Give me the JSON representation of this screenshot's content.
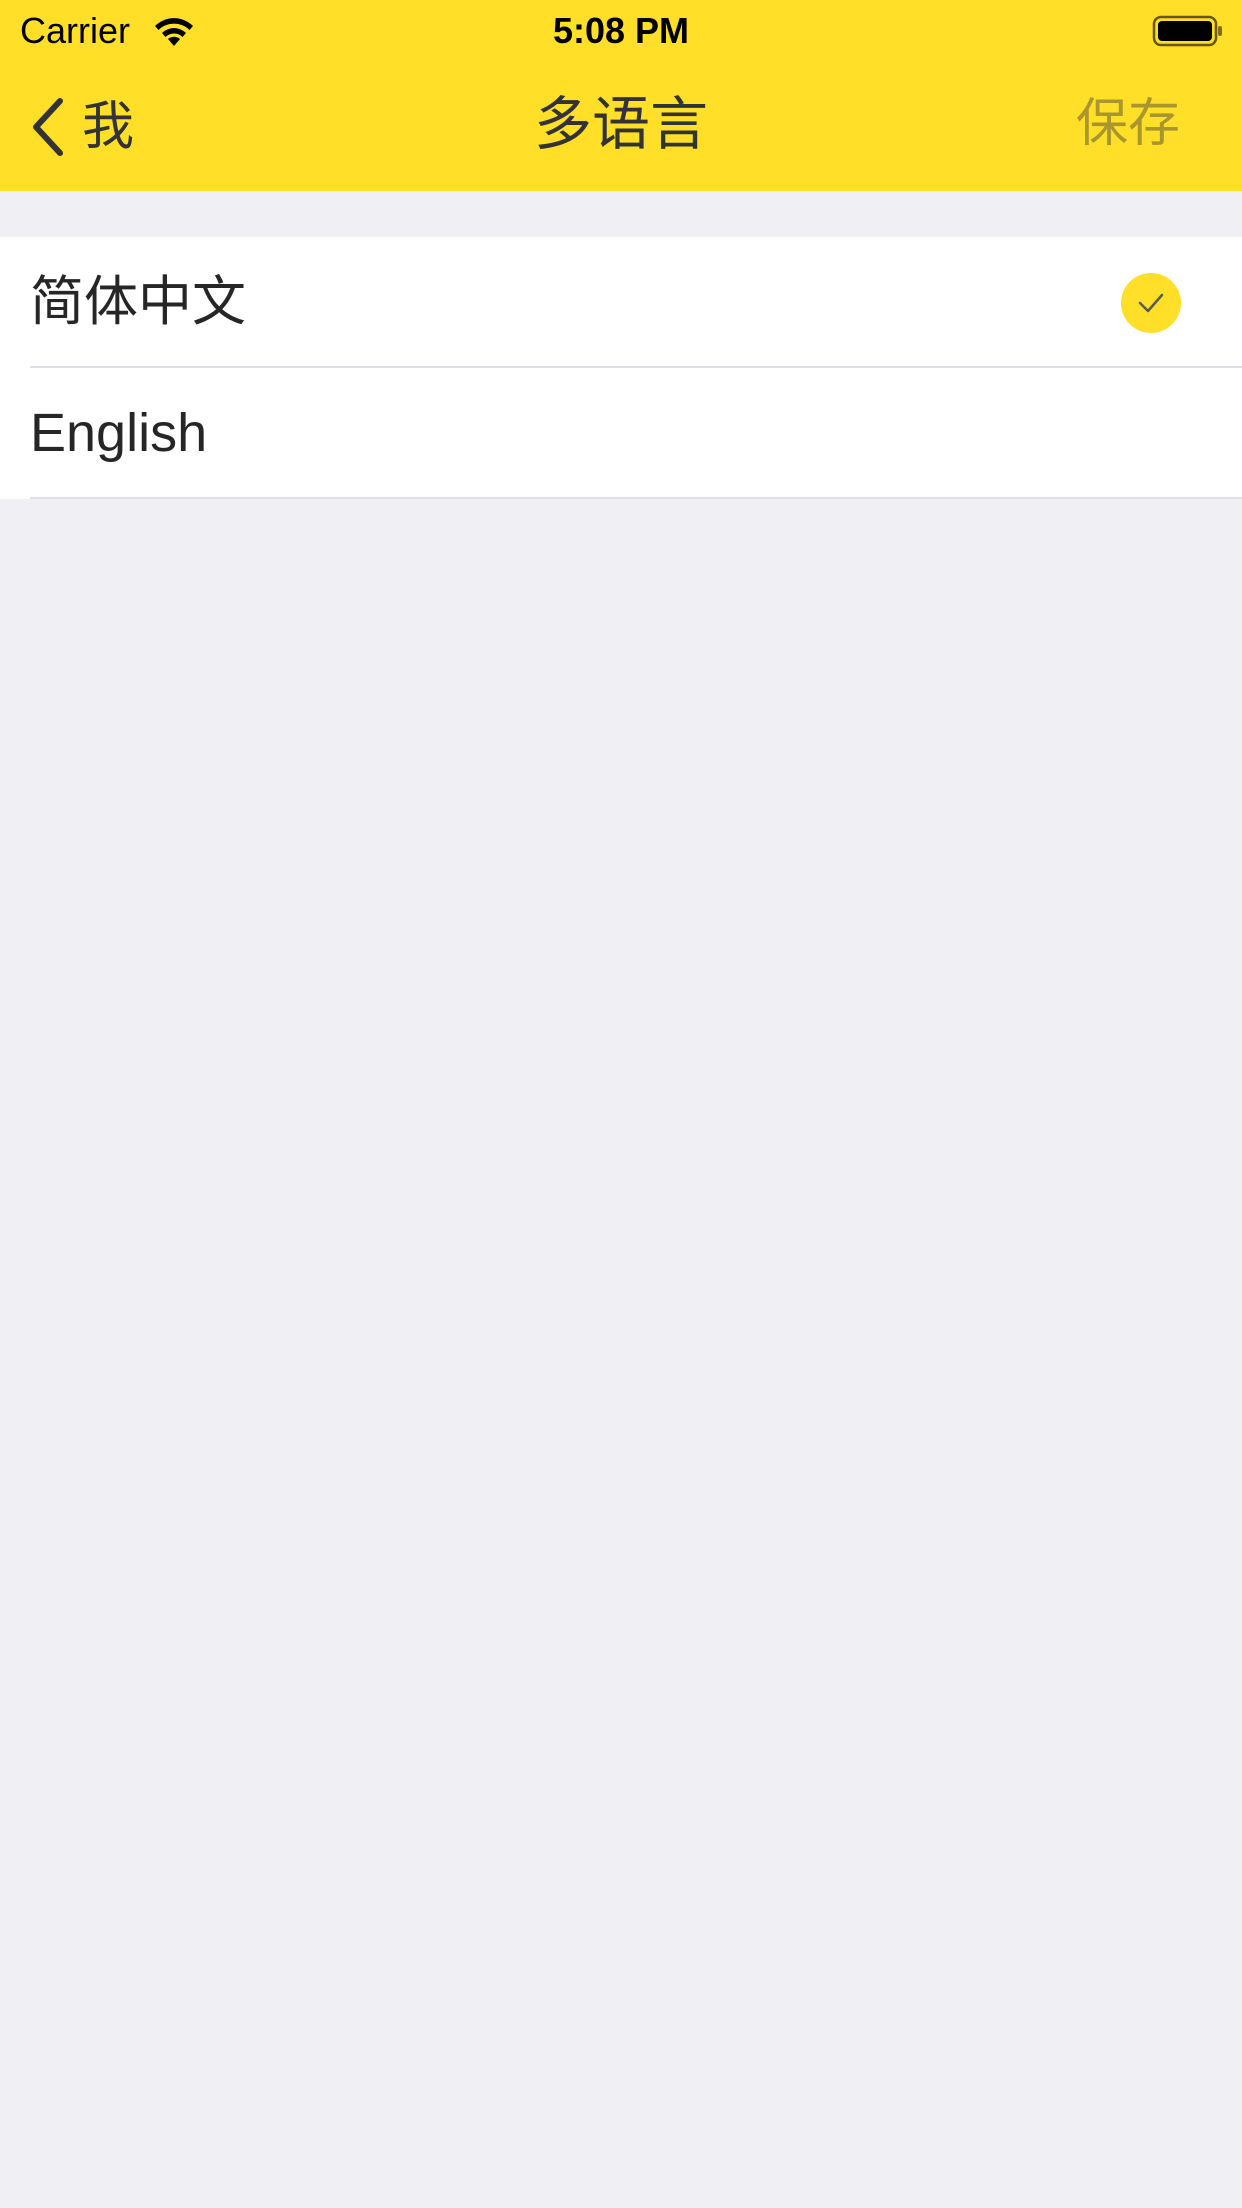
{
  "status_bar": {
    "carrier": "Carrier",
    "time": "5:08 PM",
    "icons": [
      "wifi-icon",
      "battery-icon"
    ]
  },
  "nav_bar": {
    "back_label": "我",
    "back_icon": "chevron-left-icon",
    "title": "多语言",
    "save_label": "保存"
  },
  "languages": [
    {
      "label": "简体中文",
      "selected": true,
      "check_icon": "checkmark-icon"
    },
    {
      "label": "English",
      "selected": false
    }
  ],
  "colors": {
    "accent": "#ffdf27",
    "background": "#efeff4",
    "save_text": "#a9962d"
  }
}
